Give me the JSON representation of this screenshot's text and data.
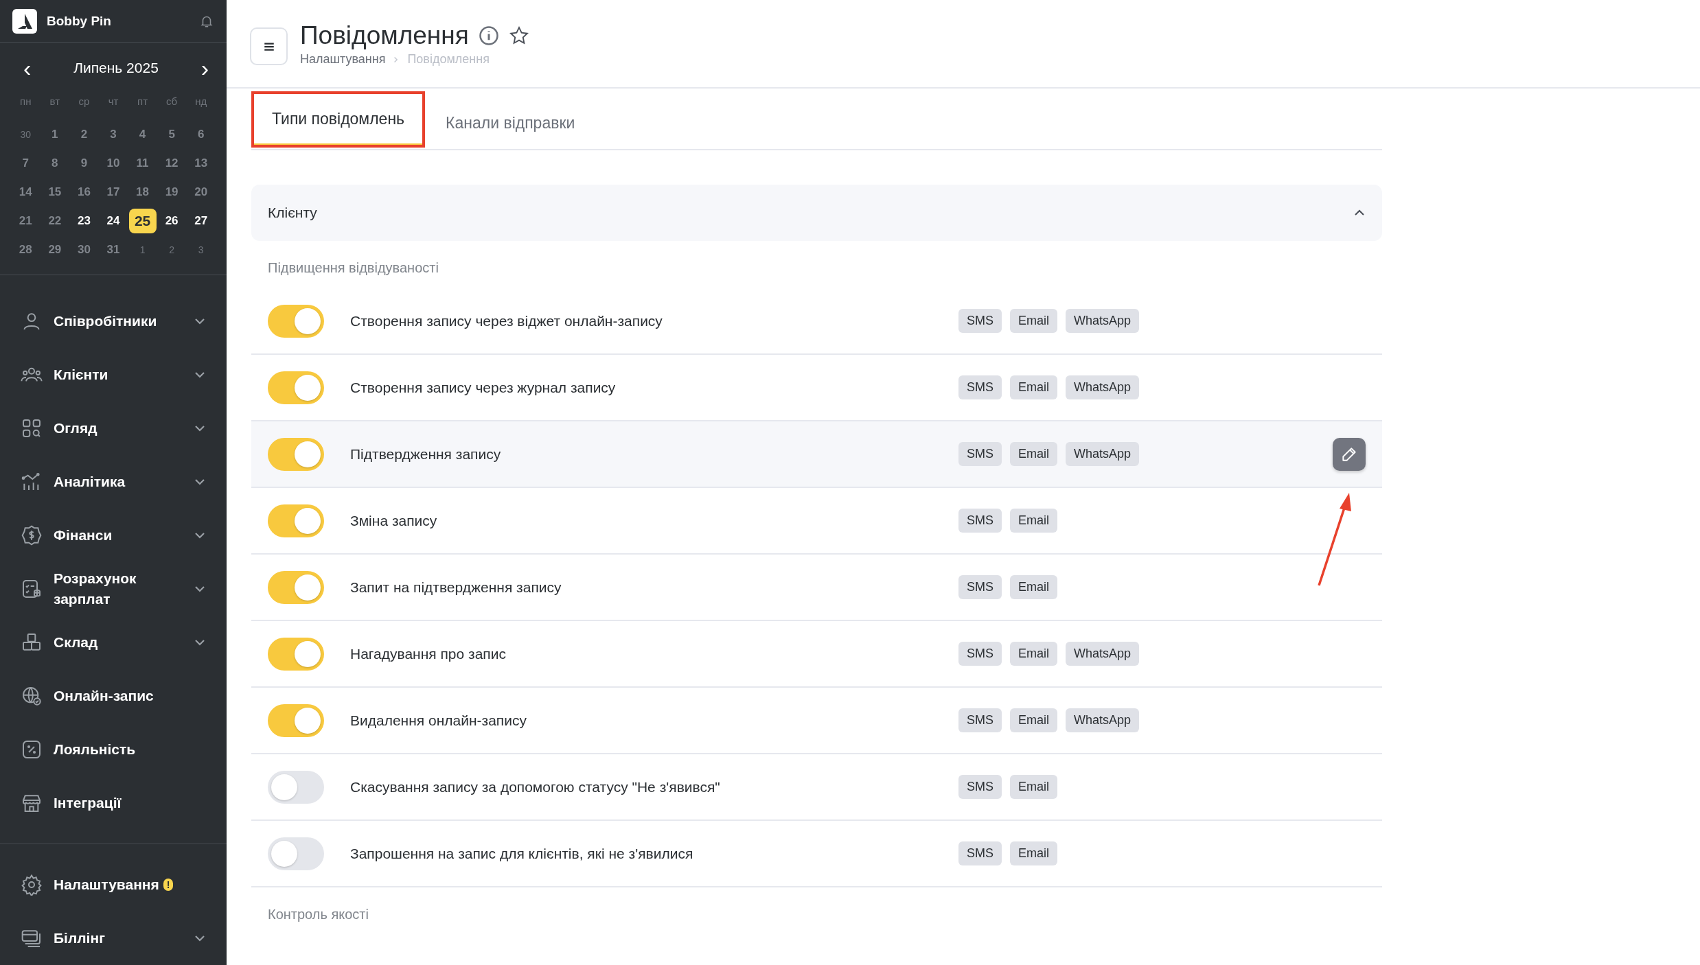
{
  "brand": {
    "name": "Bobby Pin"
  },
  "calendar": {
    "month": "Липень 2025",
    "prev": "‹",
    "next": "›",
    "weekdays": [
      "пн",
      "вт",
      "ср",
      "чт",
      "пт",
      "сб",
      "нд"
    ],
    "days": [
      {
        "label": "30",
        "kind": "other",
        "selected": false
      },
      {
        "label": "1",
        "kind": "past",
        "selected": false
      },
      {
        "label": "2",
        "kind": "past",
        "selected": false
      },
      {
        "label": "3",
        "kind": "past",
        "selected": false
      },
      {
        "label": "4",
        "kind": "past",
        "selected": false
      },
      {
        "label": "5",
        "kind": "past",
        "selected": false
      },
      {
        "label": "6",
        "kind": "past",
        "selected": false
      },
      {
        "label": "7",
        "kind": "past",
        "selected": false
      },
      {
        "label": "8",
        "kind": "past",
        "selected": false
      },
      {
        "label": "9",
        "kind": "past",
        "selected": false
      },
      {
        "label": "10",
        "kind": "past",
        "selected": false
      },
      {
        "label": "11",
        "kind": "past",
        "selected": false
      },
      {
        "label": "12",
        "kind": "past",
        "selected": false
      },
      {
        "label": "13",
        "kind": "past",
        "selected": false
      },
      {
        "label": "14",
        "kind": "past",
        "selected": false
      },
      {
        "label": "15",
        "kind": "past",
        "selected": false
      },
      {
        "label": "16",
        "kind": "past",
        "selected": false
      },
      {
        "label": "17",
        "kind": "past",
        "selected": false
      },
      {
        "label": "18",
        "kind": "past",
        "selected": false
      },
      {
        "label": "19",
        "kind": "past",
        "selected": false
      },
      {
        "label": "20",
        "kind": "past",
        "selected": false
      },
      {
        "label": "21",
        "kind": "past",
        "selected": false
      },
      {
        "label": "22",
        "kind": "past",
        "selected": false
      },
      {
        "label": "23",
        "kind": "future",
        "selected": false
      },
      {
        "label": "24",
        "kind": "future",
        "selected": false
      },
      {
        "label": "25",
        "kind": "future",
        "selected": true
      },
      {
        "label": "26",
        "kind": "future",
        "selected": false
      },
      {
        "label": "27",
        "kind": "future",
        "selected": false
      },
      {
        "label": "28",
        "kind": "past",
        "selected": false
      },
      {
        "label": "29",
        "kind": "past",
        "selected": false
      },
      {
        "label": "30",
        "kind": "past",
        "selected": false
      },
      {
        "label": "31",
        "kind": "past",
        "selected": false
      },
      {
        "label": "1",
        "kind": "other",
        "selected": false
      },
      {
        "label": "2",
        "kind": "other",
        "selected": false
      },
      {
        "label": "3",
        "kind": "other",
        "selected": false
      }
    ]
  },
  "nav": [
    {
      "label": "Співробітники",
      "expandable": true
    },
    {
      "label": "Клієнти",
      "expandable": true
    },
    {
      "label": "Огляд",
      "expandable": true
    },
    {
      "label": "Аналітика",
      "expandable": true
    },
    {
      "label": "Фінанси",
      "expandable": true
    },
    {
      "label": "Розрахунок зарплат",
      "expandable": true
    },
    {
      "label": "Склад",
      "expandable": true
    },
    {
      "label": "Онлайн-запис",
      "expandable": false
    },
    {
      "label": "Лояльність",
      "expandable": false
    },
    {
      "label": "Інтеграції",
      "expandable": false
    }
  ],
  "nav_bottom": [
    {
      "label": "Налаштування",
      "expandable": false,
      "badge": "!"
    },
    {
      "label": "Біллінг",
      "expandable": true
    }
  ],
  "header": {
    "title": "Повідомлення",
    "breadcrumbs": [
      "Налаштування",
      "Повідомлення"
    ]
  },
  "tabs": [
    {
      "label": "Типи повідомлень",
      "selected": true,
      "outlined": true
    },
    {
      "label": "Канали відправки",
      "selected": false,
      "outlined": false
    }
  ],
  "section": {
    "title": "Клієнту",
    "expanded": true,
    "group": "Підвищення відвідуваності",
    "rows": [
      {
        "label": "Створення запису через віджет онлайн-запису",
        "on": true,
        "hovered": false,
        "channels": [
          "SMS",
          "Email",
          "WhatsApp"
        ]
      },
      {
        "label": "Створення запису через журнал запису",
        "on": true,
        "hovered": false,
        "channels": [
          "SMS",
          "Email",
          "WhatsApp"
        ]
      },
      {
        "label": "Підтвердження запису",
        "on": true,
        "hovered": true,
        "channels": [
          "SMS",
          "Email",
          "WhatsApp"
        ]
      },
      {
        "label": "Зміна запису",
        "on": true,
        "hovered": false,
        "channels": [
          "SMS",
          "Email"
        ]
      },
      {
        "label": "Запит на підтвердження запису",
        "on": true,
        "hovered": false,
        "channels": [
          "SMS",
          "Email"
        ]
      },
      {
        "label": "Нагадування про запис",
        "on": true,
        "hovered": false,
        "channels": [
          "SMS",
          "Email",
          "WhatsApp"
        ]
      },
      {
        "label": "Видалення онлайн-запису",
        "on": true,
        "hovered": false,
        "channels": [
          "SMS",
          "Email",
          "WhatsApp"
        ]
      },
      {
        "label": "Скасування запису за допомогою статусу \"Не з'явився\"",
        "on": false,
        "hovered": false,
        "channels": [
          "SMS",
          "Email"
        ]
      },
      {
        "label": "Запрошення на запис для клієнтів, які не з'явилися",
        "on": false,
        "hovered": false,
        "channels": [
          "SMS",
          "Email"
        ]
      }
    ],
    "next_group": "Контроль якості"
  }
}
